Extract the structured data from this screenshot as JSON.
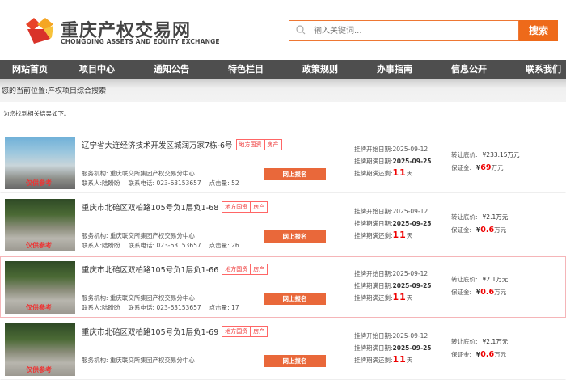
{
  "header": {
    "logo_cn": "重庆产权交易网",
    "logo_en": "CHONGQING ASSETS AND EQUITY EXCHANGE",
    "search_placeholder": "输入关键词...",
    "search_button": "搜索"
  },
  "nav": [
    "网站首页",
    "项目中心",
    "通知公告",
    "特色栏目",
    "政策规则",
    "办事指南",
    "信息公开",
    "联系我们"
  ],
  "breadcrumb": "您的当前位置:产权项目综合搜索",
  "result_tip": "为您找到相关结果如下。",
  "labels": {
    "org": "服务机构: ",
    "contact": "联系人:",
    "phone": "联系电话: ",
    "clicks": "点击量: ",
    "apply": "网上报名",
    "start": "挂牌开始日期:",
    "end": "挂牌期满日期:",
    "remain": "挂牌期满还剩:",
    "day_unit": "天",
    "price": "转让底价:",
    "deposit": "保证金:",
    "yuan": "¥",
    "wan": "万元",
    "watermark": "仅供参考"
  },
  "items": [
    {
      "title": "辽宁省大连经济技术开发区城润万家7栋-6号",
      "tags": [
        "地方国资",
        "房产"
      ],
      "org": "重庆联交所集团产权交易分中心",
      "contact": "陆盼盼",
      "phone": "023-63153657",
      "clicks": "52",
      "start": "2025-09-12",
      "end": "2025-09-25",
      "remain": "11",
      "price": "¥233.15",
      "deposit": "69"
    },
    {
      "title": "重庆市北碚区双柏路105号负1层负1-68",
      "tags": [
        "地方国资",
        "房产"
      ],
      "org": "重庆联交所集团产权交易分中心",
      "contact": "陆盼盼",
      "phone": "023-63153657",
      "clicks": "26",
      "start": "2025-09-12",
      "end": "2025-09-25",
      "remain": "11",
      "price": "¥2.1",
      "deposit": "0.6"
    },
    {
      "title": "重庆市北碚区双柏路105号负1层负1-66",
      "tags": [
        "地方国资",
        "房产"
      ],
      "org": "重庆联交所集团产权交易分中心",
      "contact": "陆盼盼",
      "phone": "023-63153657",
      "clicks": "17",
      "start": "2025-09-12",
      "end": "2025-09-25",
      "remain": "11",
      "price": "¥2.1",
      "deposit": "0.6"
    },
    {
      "title": "重庆市北碚区双柏路105号负1层负1-69",
      "tags": [
        "地方国资",
        "房产"
      ],
      "org": "重庆联交所集团产权交易分中心",
      "contact": "",
      "phone": "",
      "clicks": "",
      "start": "2025-09-12",
      "end": "2025-09-25",
      "remain": "11",
      "price": "¥2.1",
      "deposit": "0.6"
    }
  ]
}
